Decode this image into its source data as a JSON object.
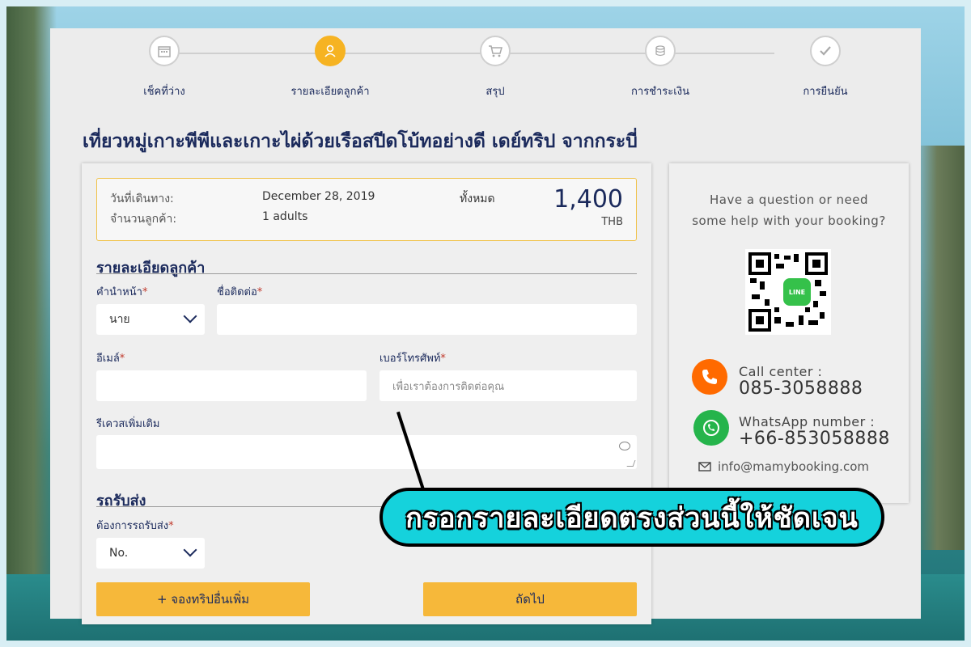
{
  "steps": [
    {
      "label": "เช็คที่ว่าง",
      "icon": "calendar-icon",
      "active": false
    },
    {
      "label": "รายละเอียดลูกค้า",
      "icon": "person-icon",
      "active": true
    },
    {
      "label": "สรุป",
      "icon": "cart-icon",
      "active": false
    },
    {
      "label": "การชำระเงิน",
      "icon": "coins-icon",
      "active": false
    },
    {
      "label": "การยืนยัน",
      "icon": "check-icon",
      "active": false
    }
  ],
  "page_title": "เที่ยวหมู่เกาะพีพีและเกาะไผ่ด้วยเรือสปีดโบ้ทอย่างดี เดย์ทริป จากกระบี่",
  "summary": {
    "date_label": "วันที่เดินทาง:",
    "date_value": "December 28, 2019",
    "guests_label": "จำนวนลูกค้า:",
    "guests_value": "1 adults",
    "total_label": "ทั้งหมด",
    "total_amount": "1,400",
    "currency": "THB"
  },
  "customer_section": {
    "heading": "รายละเอียดลูกค้า",
    "title_label": "คำนำหน้า",
    "title_value": "นาย",
    "name_label": "ชื่อติดต่อ",
    "email_label": "อีเมล์",
    "phone_label": "เบอร์โทรศัพท์",
    "phone_placeholder": "เพื่อเราต้องการติดต่อคุณ",
    "request_label": "รีเควสเพิ่มเติม",
    "required_mark": "*"
  },
  "transfer_section": {
    "heading": "รถรับส่ง",
    "need_label": "ต้องการรถรับส่ง",
    "need_value": "No."
  },
  "buttons": {
    "add_trip": "+ จองทริปอื่นเพิ่ม",
    "next": "ถัดไป"
  },
  "help": {
    "question_line1": "Have a question or need",
    "question_line2": "some help with your booking?",
    "qr_badge": "LINE",
    "call_label": "Call center :",
    "call_value": "085-3058888",
    "whatsapp_label": "WhatsApp number :",
    "whatsapp_value": "+66-853058888",
    "email": "info@mamybooking.com"
  },
  "annotation": "กรอกรายละเอียดตรงส่วนนี้ให้ชัดเจน",
  "colors": {
    "accent": "#f6b322",
    "navy": "#1b2a5c",
    "call": "#ff6a00",
    "whatsapp": "#25b44b",
    "callout": "#15d2dc"
  }
}
